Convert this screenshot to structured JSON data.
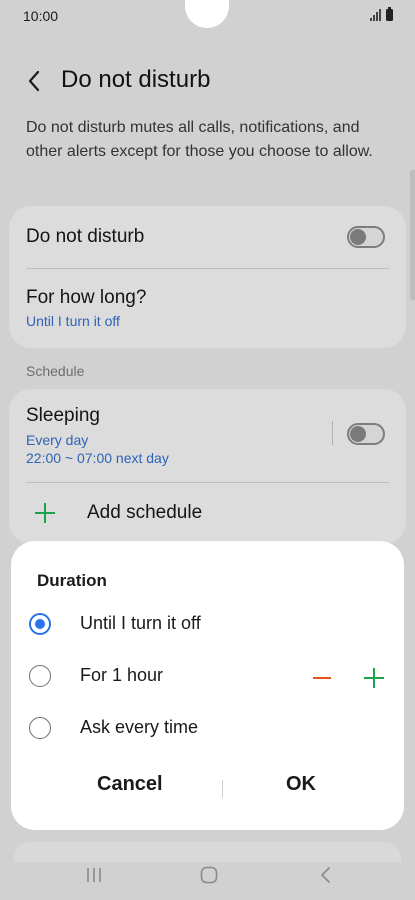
{
  "status_bar": {
    "time": "10:00"
  },
  "header": {
    "title": "Do not disturb",
    "description": "Do not disturb mutes all calls, notifications, and other alerts except for those you choose to allow."
  },
  "settings": {
    "dnd_label": "Do not disturb",
    "dnd_enabled": false,
    "how_long_label": "For how long?",
    "how_long_value": "Until I turn it off"
  },
  "schedule": {
    "section_label": "Schedule",
    "items": [
      {
        "title": "Sleeping",
        "days": "Every day",
        "time": "22:00 ~ 07:00 next day",
        "enabled": false
      }
    ],
    "add_label": "Add schedule"
  },
  "dialog": {
    "title": "Duration",
    "options": [
      {
        "label": "Until I turn it off",
        "selected": true
      },
      {
        "label": "For 1 hour",
        "selected": false
      },
      {
        "label": "Ask every time",
        "selected": false
      }
    ],
    "cancel_label": "Cancel",
    "ok_label": "OK"
  },
  "colors": {
    "accent_blue": "#2a73e8",
    "link_blue": "#2e63b8",
    "minus_red": "#e8531c",
    "plus_green": "#1aa34a"
  },
  "icons": {
    "back": "chevron-left-icon",
    "add": "plus-icon",
    "decrease": "minus-icon",
    "increase": "plus-icon",
    "nav_recent": "recent-apps-icon",
    "nav_home": "home-icon",
    "nav_back": "back-icon"
  }
}
